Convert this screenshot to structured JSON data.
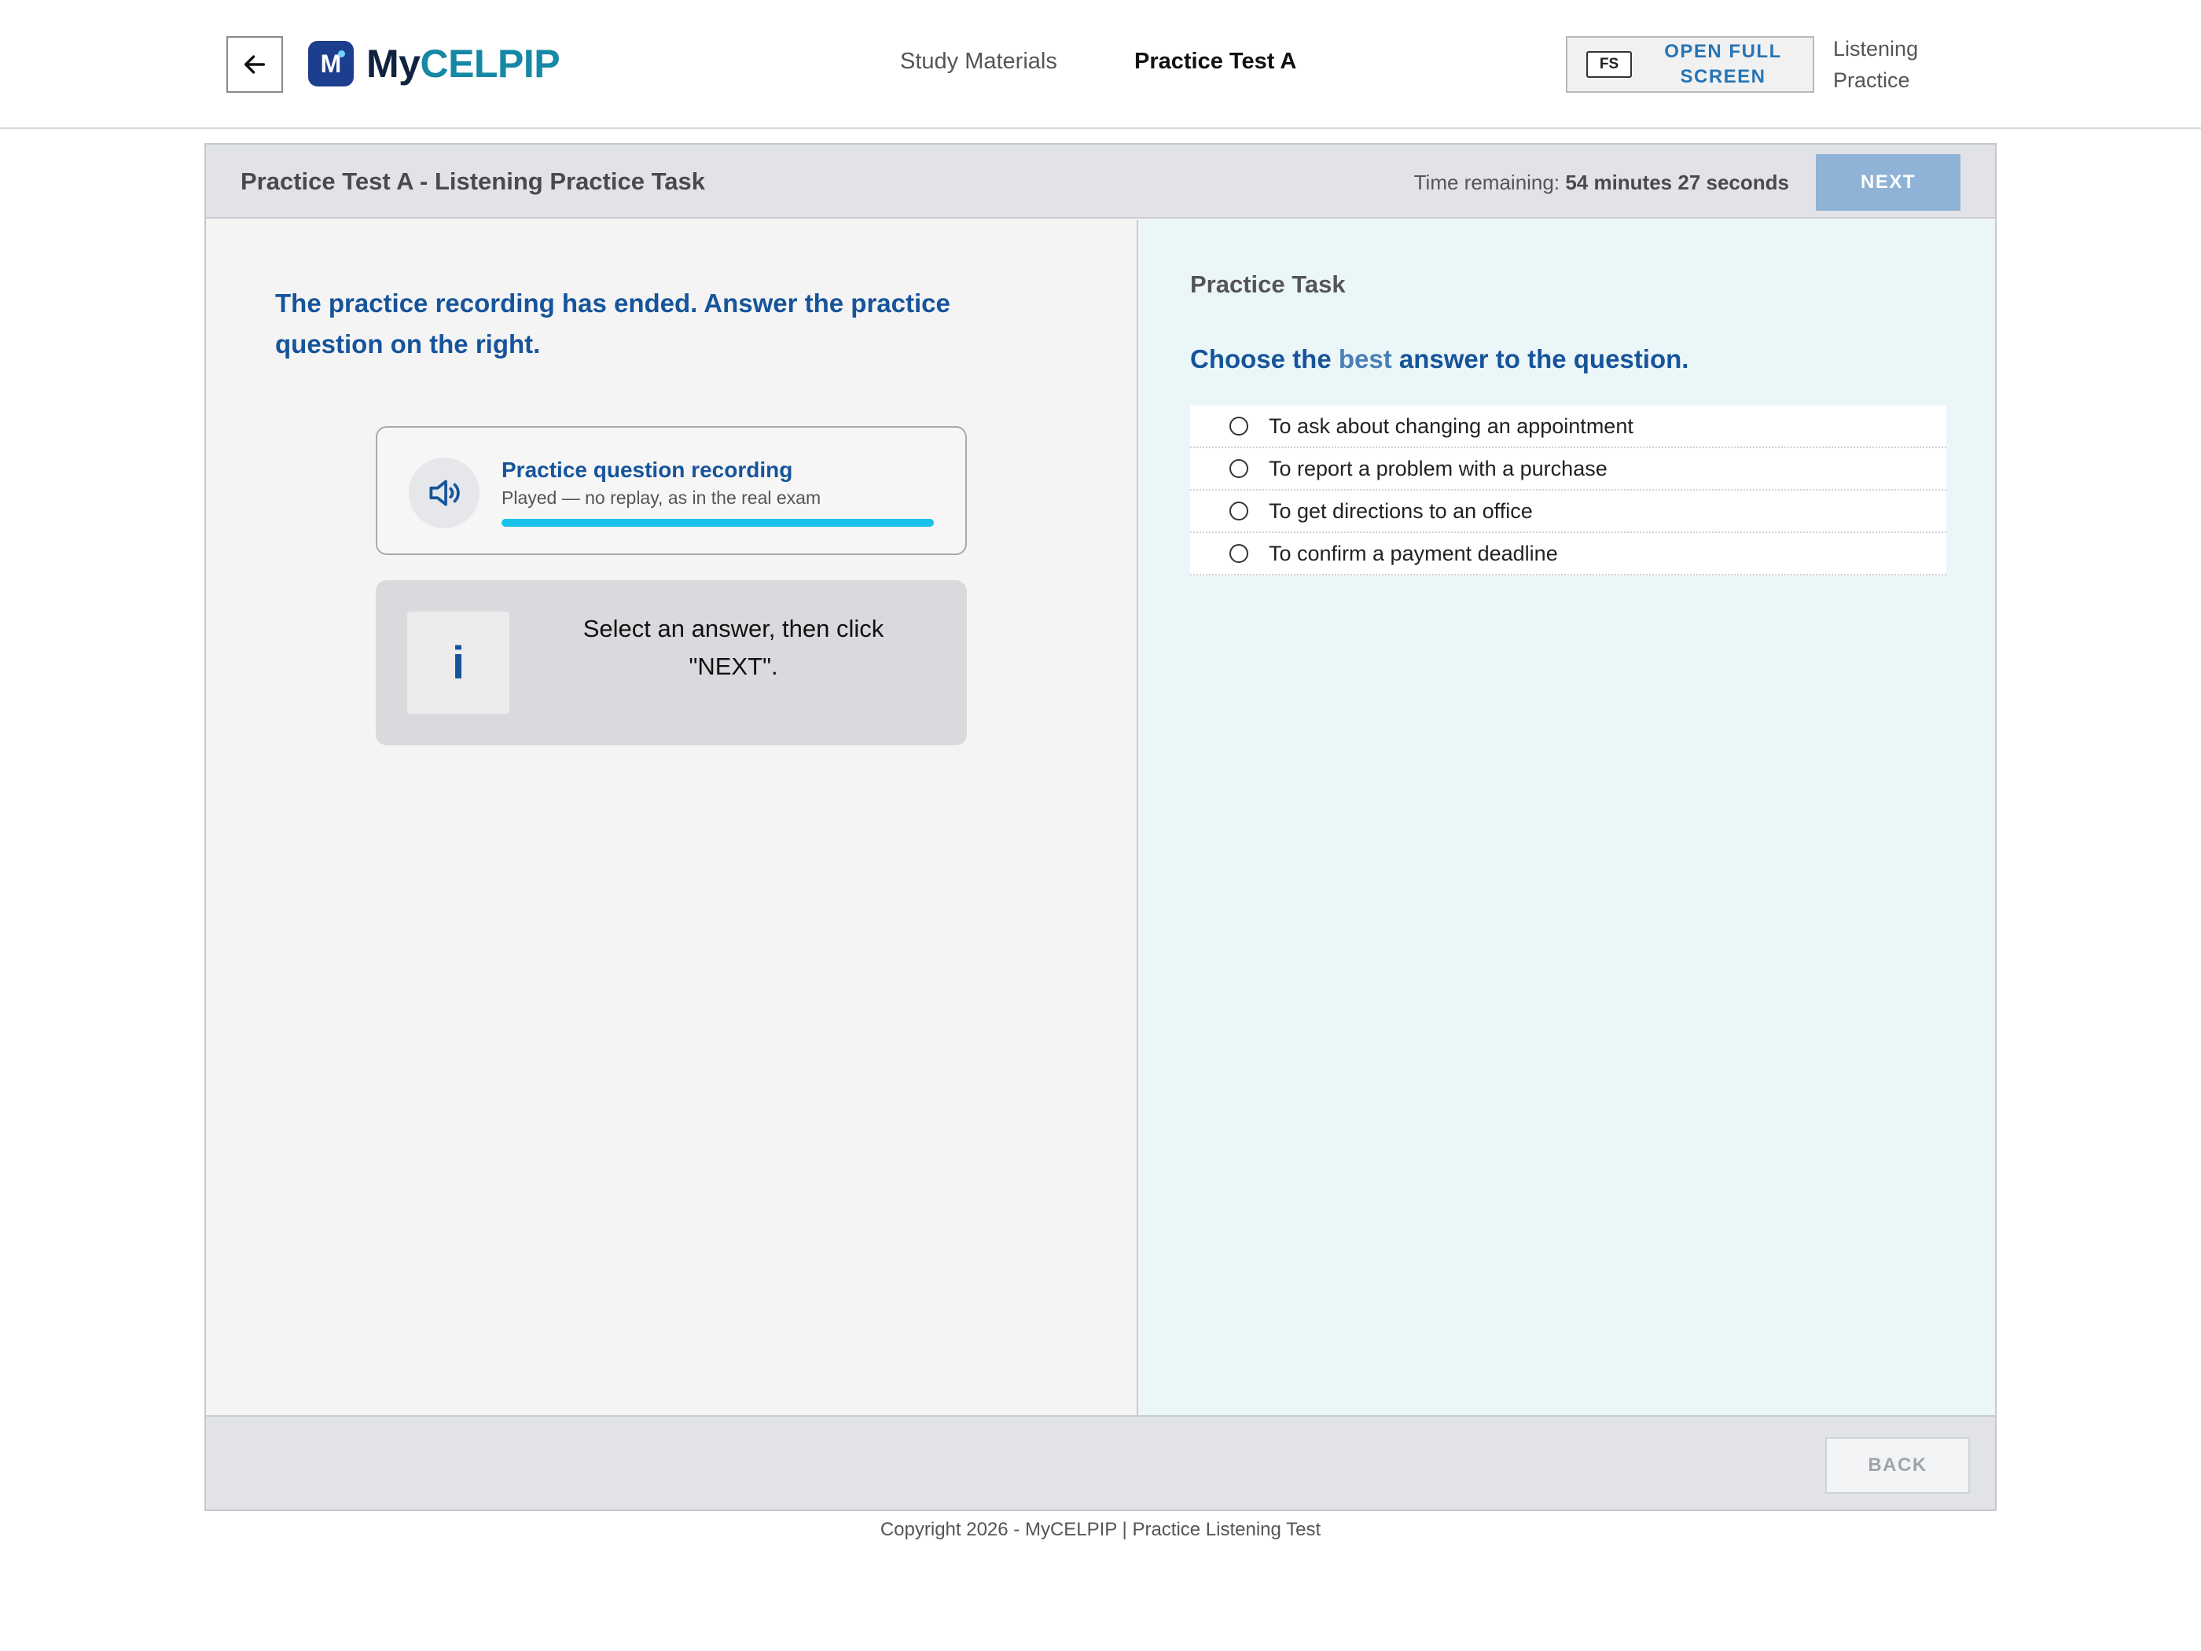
{
  "header": {
    "back_icon": "arrow-left-icon",
    "logo": {
      "mark": "M",
      "text_my": "My",
      "text_brand": "CELPIP"
    },
    "nav": {
      "study_materials": "Study Materials",
      "practice_test": "Practice Test A"
    },
    "fullscreen": {
      "badge": "FS",
      "label": "OPEN FULL SCREEN"
    },
    "mode_label": "Listening Practice"
  },
  "test": {
    "title": "Practice Test A - Listening Practice Task",
    "timer_prefix": "Time remaining:",
    "timer_value": "54 minutes 27 seconds",
    "next_label": "NEXT",
    "back_label": "BACK"
  },
  "left": {
    "instruction": "The practice recording has ended. Answer the practice question on the right.",
    "player": {
      "icon": "speaker-icon",
      "title": "Practice question recording",
      "subtitle": "Played — no replay, as in the real exam",
      "progress_percent": 100
    },
    "info": {
      "icon": "info-icon",
      "icon_glyph": "i",
      "text": "Select an answer, then click \"NEXT\"."
    }
  },
  "right": {
    "task_label": "Practice Task",
    "question_pre": "Choose the ",
    "question_highlight": "best",
    "question_post": " answer to the question.",
    "options": [
      "To ask about changing an appointment",
      "To report a problem with a purchase",
      "To get directions to an office",
      "To confirm a payment deadline"
    ]
  },
  "footer": {
    "copyright": "Copyright 2026 - MyCELPIP | Practice Listening Test"
  },
  "colors": {
    "brand_blue": "#16549b",
    "brand_teal": "#1588a6",
    "next_button": "#8fb3d6",
    "progress": "#18c2ea",
    "right_pane": "#ebf6f8"
  }
}
